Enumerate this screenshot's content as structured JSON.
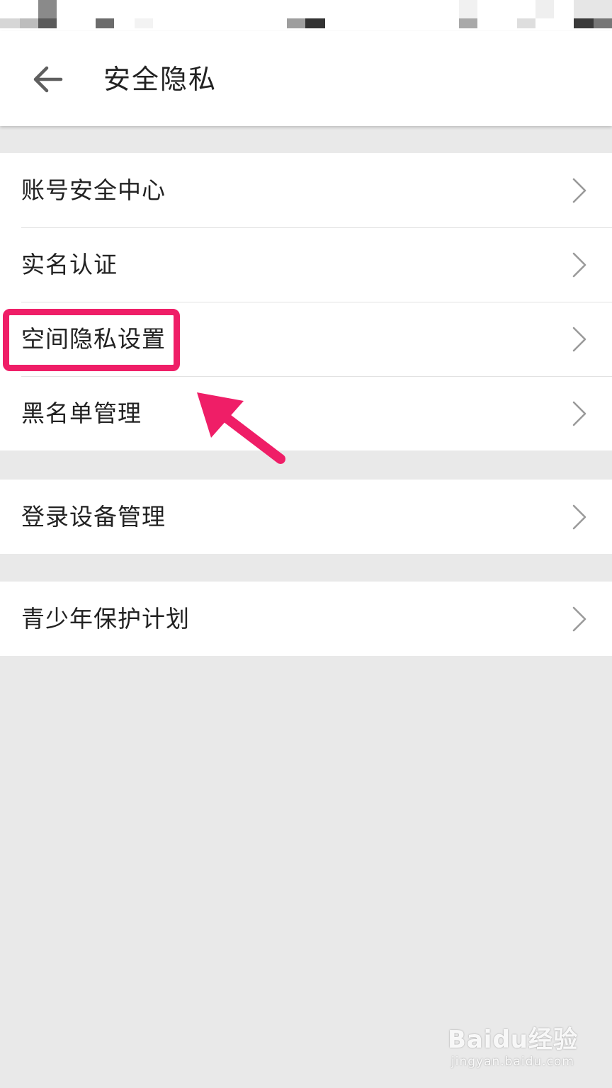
{
  "header": {
    "back_icon": "arrow-left-icon",
    "title": "安全隐私"
  },
  "groups": [
    {
      "items": [
        {
          "label": "账号安全中心",
          "icon": "chevron-right-icon"
        },
        {
          "label": "实名认证",
          "icon": "chevron-right-icon"
        },
        {
          "label": "空间隐私设置",
          "icon": "chevron-right-icon",
          "highlighted": true
        },
        {
          "label": "黑名单管理",
          "icon": "chevron-right-icon"
        }
      ]
    },
    {
      "items": [
        {
          "label": "登录设备管理",
          "icon": "chevron-right-icon"
        }
      ]
    },
    {
      "items": [
        {
          "label": "青少年保护计划",
          "icon": "chevron-right-icon"
        }
      ]
    }
  ],
  "annotation": {
    "color": "#ef1e67",
    "target": "空间隐私设置"
  },
  "watermark": {
    "logo": "Baidu经验",
    "url": "jingyan.baidu.com"
  },
  "colors": {
    "background": "#e9e9e9",
    "surface": "#ffffff",
    "text": "#222222",
    "chevron": "#9a9a9a",
    "accent": "#ef1e67"
  }
}
